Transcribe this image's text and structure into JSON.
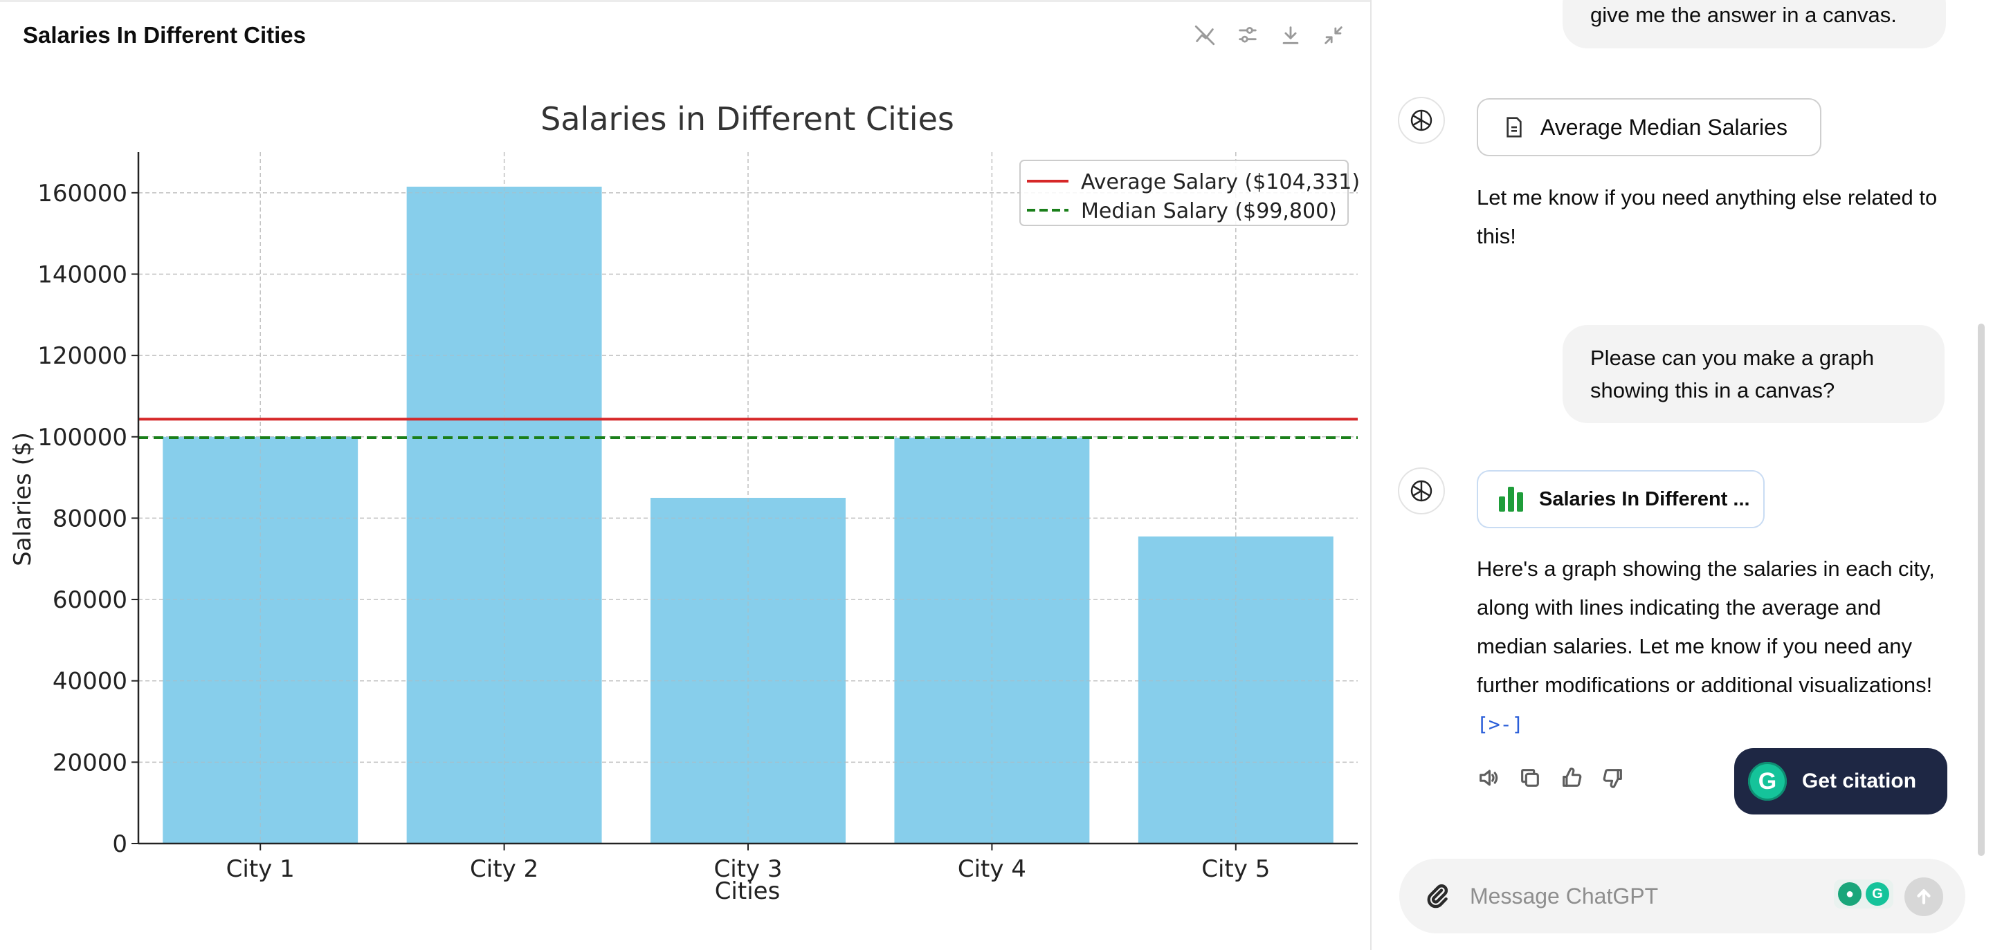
{
  "canvas": {
    "title": "Salaries In Different Cities",
    "toolbar": [
      "chart-interaction-icon",
      "adjust-sliders-icon",
      "download-icon",
      "collapse-icon"
    ]
  },
  "chart_data": {
    "type": "bar",
    "title": "Salaries in Different Cities",
    "xlabel": "Cities",
    "ylabel": "Salaries ($)",
    "categories": [
      "City 1",
      "City 2",
      "City 3",
      "City 4",
      "City 5"
    ],
    "values": [
      100000,
      161500,
      85000,
      99800,
      75500
    ],
    "ylim": [
      0,
      170000
    ],
    "yticks": [
      0,
      20000,
      40000,
      60000,
      80000,
      100000,
      120000,
      140000,
      160000
    ],
    "bar_color": "#87ceeb",
    "grid": true,
    "reference_lines": [
      {
        "name": "Average Salary ($104,331)",
        "value": 104331,
        "color": "#d62728",
        "style": "solid"
      },
      {
        "name": "Median Salary ($99,800)",
        "value": 99800,
        "color": "#1a7f1a",
        "style": "dashed"
      }
    ],
    "legend_position": "top-right"
  },
  "chat": {
    "user_top": "give me the answer in a canvas.",
    "doc_card_label": "Average Median Salaries",
    "bot_msg_1": "Let me know if you need anything else related to this!",
    "user_question": "Please can you make a graph showing this in a canvas?",
    "chart_card_label": "Salaries In Different ...",
    "bot_msg_2": "Here's a graph showing the salaries in each city, along with lines indicating the average and median salaries. Let me know if you need any further modifications or additional visualizations!",
    "cite_marker": "[>-]",
    "actions": [
      "read-aloud-icon",
      "copy-icon",
      "thumbs-up-icon",
      "thumbs-down-icon"
    ],
    "get_citation_label": "Get citation",
    "composer_placeholder": "Message ChatGPT"
  }
}
